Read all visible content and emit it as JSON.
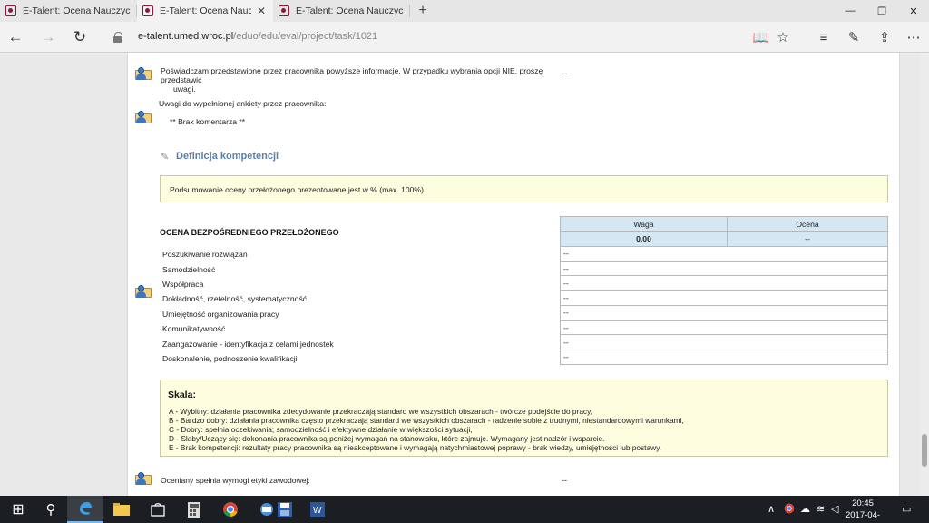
{
  "browser": {
    "tabs": [
      {
        "title": "E-Talent: Ocena Nauczycieli",
        "active": false
      },
      {
        "title": "E-Talent: Ocena Nauczy",
        "active": true
      },
      {
        "title": "E-Talent: Ocena Nauczycieli",
        "active": false
      }
    ],
    "close_glyph": "✕",
    "new_tab_glyph": "+",
    "window_controls": {
      "minimize": "—",
      "restore": "❐",
      "close": "✕"
    },
    "url_host": "e-talent.umed.wroc.pl",
    "url_prefix": "",
    "url_path": "/eduo/edu/eval/project/task/1021",
    "nav": {
      "back": "←",
      "forward": "→",
      "refresh": "↻"
    },
    "toolbar": {
      "reading": "📖",
      "favorite": "☆",
      "hub": "≡",
      "notes": "✎",
      "share": "⇪",
      "more": "⋯"
    }
  },
  "page": {
    "confirm_text_line1": "Poświadczam przedstawione  przez pracownika powyższe informacje. W przypadku wybrania opcji NIE, proszę przedstawić",
    "confirm_text_line2": "uwagi.",
    "confirm_value": "--",
    "remarks_label": "Uwagi do wypełnionej ankiety przez pracownika:",
    "remarks_value": "** Brak komentarza **",
    "section_title": "Definicja kompetencji",
    "summary_note": "Podsumowanie oceny przełożonego prezentowane jest w % (max. 100%).",
    "supervisor_heading": "OCENA BEZPOŚREDNIEGO PRZEŁOŻONEGO",
    "grid_headers": {
      "weight": "Waga",
      "rating": "Ocena"
    },
    "grid_totals": {
      "weight": "0,00",
      "rating": "--"
    },
    "criteria": [
      {
        "label": "Poszukiwanie rozwiązań",
        "value": "--"
      },
      {
        "label": "Samodzielność",
        "value": "--"
      },
      {
        "label": "Współpraca",
        "value": "--"
      },
      {
        "label": "Dokładność, rzetelność, systematyczność",
        "value": "--"
      },
      {
        "label": "Umiejętność organizowania pracy",
        "value": "--"
      },
      {
        "label": "Komunikatywność",
        "value": "--"
      },
      {
        "label": "Zaangażowanie - identyfikacja z celami jednostek",
        "value": "--"
      },
      {
        "label": "Doskonalenie, podnoszenie kwalifikacji",
        "value": "--"
      }
    ],
    "scale": {
      "title": "Skala:",
      "lines": [
        "A  - Wybitny: działania pracownika zdecydowanie przekraczają standard we wszystkich obszarach - twórcze podejście do pracy,",
        "B  - Bardzo dobry: działania pracownika często przekraczają standard we wszystkich obszarach  -  radzenie sobie z trudnymi, niestandardowymi warunkami,",
        "C  - Dobry: spełnia oczekiwania; samodzielność i efektywne działanie w większości  sytuacji,",
        "D - Słaby/Uczący się: dokonania pracownika są poniżej wymagań na stanowisku, które zajmuje. Wymagany jest nadzór i wsparcie.",
        "E -  Brak kompetencji: rezultaty pracy pracownika są nieakceptowane i wymagają natychmiastowej poprawy - brak wiedzy, umiejętności lub postawy."
      ]
    },
    "ethics_label": "Oceniany spełnia wymogi etyki zawodowej:",
    "ethics_value": "--"
  },
  "taskbar": {
    "start": "⊞",
    "search": "⚲",
    "time": "20:45",
    "date": "2017-04-02",
    "tray_up": "∧",
    "notifications": "▭"
  },
  "colors": {
    "grid_header_bg": "#d5e7f3",
    "note_bg": "#fdfde0",
    "section_title": "#5b80ab",
    "taskbar_bg": "#1b1f24"
  }
}
